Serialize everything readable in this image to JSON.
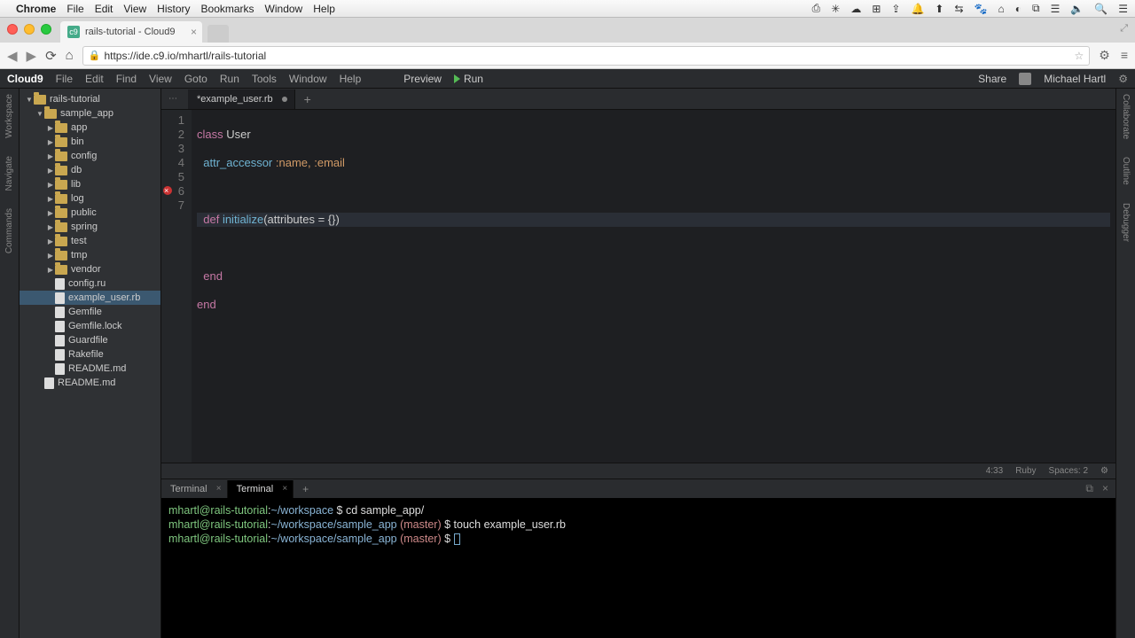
{
  "mac": {
    "app": "Chrome",
    "menus": [
      "File",
      "Edit",
      "View",
      "History",
      "Bookmarks",
      "Window",
      "Help"
    ],
    "tray": [
      "⎙",
      "✳",
      "☁",
      "⊞",
      "⇪",
      "🔔",
      "⬆",
      "⇆",
      "🐾",
      "⌂",
      "◐",
      "⧉",
      "☰",
      "🔈",
      "🔍",
      "☰"
    ]
  },
  "chrome": {
    "tab_title": "rails-tutorial - Cloud9",
    "url": "https://ide.c9.io/mhartl/rails-tutorial"
  },
  "ide": {
    "logo": "Cloud9",
    "menus": [
      "File",
      "Edit",
      "Find",
      "View",
      "Goto",
      "Run",
      "Tools",
      "Window",
      "Help"
    ],
    "preview": "Preview",
    "run": "Run",
    "share": "Share",
    "user": "Michael Hartl",
    "left_tabs": [
      "Workspace",
      "Navigate",
      "Commands"
    ],
    "right_tabs": [
      "Collaborate",
      "Outline",
      "Debugger"
    ],
    "filetree": [
      {
        "indent": 0,
        "type": "folder",
        "open": true,
        "label": "rails-tutorial"
      },
      {
        "indent": 1,
        "type": "folder",
        "open": true,
        "label": "sample_app"
      },
      {
        "indent": 2,
        "type": "folder",
        "open": false,
        "label": "app"
      },
      {
        "indent": 2,
        "type": "folder",
        "open": false,
        "label": "bin"
      },
      {
        "indent": 2,
        "type": "folder",
        "open": false,
        "label": "config"
      },
      {
        "indent": 2,
        "type": "folder",
        "open": false,
        "label": "db"
      },
      {
        "indent": 2,
        "type": "folder",
        "open": false,
        "label": "lib"
      },
      {
        "indent": 2,
        "type": "folder",
        "open": false,
        "label": "log"
      },
      {
        "indent": 2,
        "type": "folder",
        "open": false,
        "label": "public"
      },
      {
        "indent": 2,
        "type": "folder",
        "open": false,
        "label": "spring"
      },
      {
        "indent": 2,
        "type": "folder",
        "open": false,
        "label": "test"
      },
      {
        "indent": 2,
        "type": "folder",
        "open": false,
        "label": "tmp"
      },
      {
        "indent": 2,
        "type": "folder",
        "open": false,
        "label": "vendor"
      },
      {
        "indent": 2,
        "type": "file",
        "label": "config.ru"
      },
      {
        "indent": 2,
        "type": "file",
        "label": "example_user.rb",
        "sel": true
      },
      {
        "indent": 2,
        "type": "file",
        "label": "Gemfile"
      },
      {
        "indent": 2,
        "type": "file",
        "label": "Gemfile.lock"
      },
      {
        "indent": 2,
        "type": "file",
        "label": "Guardfile"
      },
      {
        "indent": 2,
        "type": "file",
        "label": "Rakefile"
      },
      {
        "indent": 2,
        "type": "file",
        "label": "README.md"
      },
      {
        "indent": 1,
        "type": "file",
        "label": "README.md"
      }
    ],
    "tab_name": "*example_user.rb",
    "code": {
      "l1": {
        "kw": "class",
        "id": "User"
      },
      "l2": {
        "attr": "attr_accessor",
        "syms": ":name, :email"
      },
      "l4": {
        "kw": "def",
        "fn": "initialize",
        "args": "(attributes = {})"
      },
      "l6": "end",
      "l7": "end"
    },
    "status": {
      "pos": "4:33",
      "lang": "Ruby",
      "spaces": "Spaces: 2"
    },
    "term_tabs": [
      "Terminal",
      "Terminal"
    ],
    "term_lines": [
      {
        "prompt": "mhartl@rails-tutorial",
        "path": "~/workspace",
        "branch": "",
        "sep": " $ ",
        "cmd": "cd sample_app/"
      },
      {
        "prompt": "mhartl@rails-tutorial",
        "path": "~/workspace/sample_app",
        "branch": " (master)",
        "sep": " $ ",
        "cmd": "touch example_user.rb"
      },
      {
        "prompt": "mhartl@rails-tutorial",
        "path": "~/workspace/sample_app",
        "branch": " (master)",
        "sep": " $ ",
        "cmd": ""
      }
    ]
  }
}
